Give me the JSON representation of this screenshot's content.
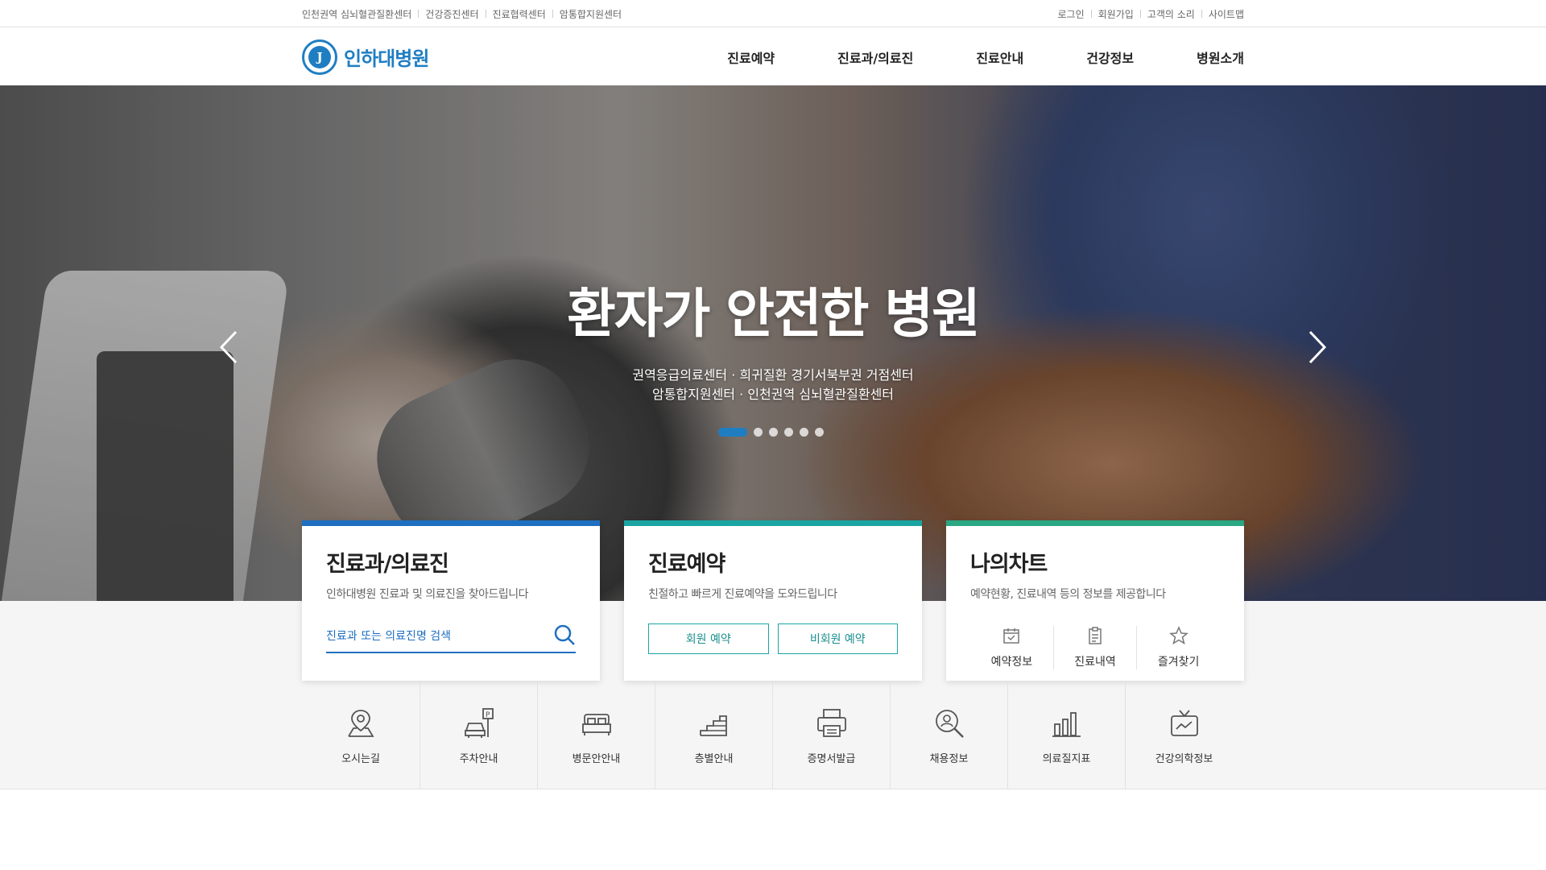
{
  "util": {
    "left_links": [
      "인천권역 심뇌혈관질환센터",
      "건강증진센터",
      "진료협력센터",
      "암통합지원센터"
    ],
    "right_links": [
      "로그인",
      "회원가입",
      "고객의 소리",
      "사이트맵"
    ]
  },
  "header": {
    "logo_text": "인하대병원",
    "logo_mark": "J",
    "nav": [
      "진료예약",
      "진료과/의료진",
      "진료안내",
      "건강정보",
      "병원소개"
    ]
  },
  "hero": {
    "title": "환자가 안전한 병원",
    "subtitle_line1": "권역응급의료센터 · 희귀질환 경기서북부권 거점센터",
    "subtitle_line2": "암통합지원센터 · 인천권역 심뇌혈관질환센터",
    "slide_count": 6,
    "active_slide": 1
  },
  "cards": {
    "doctors": {
      "title": "진료과/의료진",
      "desc": "인하대병원 진료과 및 의료진을 찾아드립니다",
      "search_placeholder": "진료과 또는 의료진명 검색"
    },
    "reservation": {
      "title": "진료예약",
      "desc": "친절하고 빠르게 진료예약을 도와드립니다",
      "member_btn": "회원 예약",
      "guest_btn": "비회원 예약"
    },
    "mychart": {
      "title": "나의차트",
      "desc": "예약현황, 진료내역 등의 정보를 제공합니다",
      "items": [
        "예약정보",
        "진료내역",
        "즐겨찾기"
      ]
    }
  },
  "quick_menu": [
    {
      "label": "오시는길",
      "icon": "map-pin-icon"
    },
    {
      "label": "주차안내",
      "icon": "parking-car-icon"
    },
    {
      "label": "병문안안내",
      "icon": "bed-icon"
    },
    {
      "label": "층별안내",
      "icon": "stairs-icon"
    },
    {
      "label": "증명서발급",
      "icon": "printer-icon"
    },
    {
      "label": "채용정보",
      "icon": "search-person-icon"
    },
    {
      "label": "의료질지표",
      "icon": "bar-chart-icon"
    },
    {
      "label": "건강의학정보",
      "icon": "tv-health-icon"
    }
  ],
  "colors": {
    "brand_blue": "#1f7ec2",
    "card1_bar": "#1f6fc0",
    "card2_bar": "#1aa5a3",
    "card3_bar": "#2aa783"
  }
}
